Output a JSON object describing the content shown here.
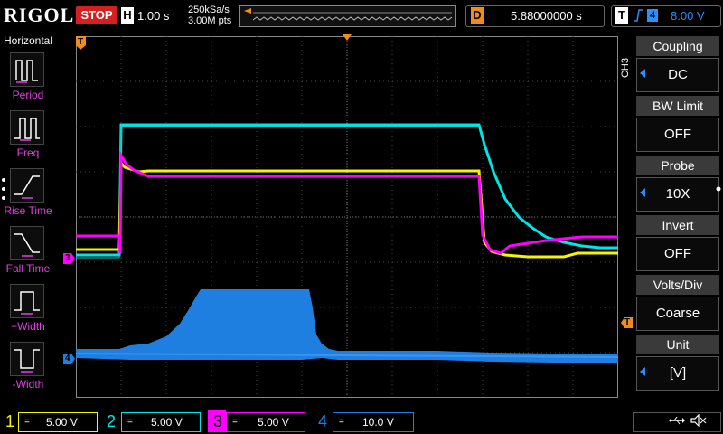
{
  "topbar": {
    "brand": "RIGOL",
    "run_state": "STOP",
    "h_badge": "H",
    "timebase": "1.00 s",
    "sample_rate": "250kSa/s",
    "memory_depth": "3.00M pts",
    "delay_badge": "D",
    "delay_value": "5.88000000 s",
    "trigger_badge": "T",
    "trigger_edge_icon": "rising-edge-icon",
    "trigger_source": "4",
    "trigger_level": "8.00 V"
  },
  "left_menu": {
    "header": "Horizontal",
    "items": [
      {
        "label": "Period",
        "icon": "period-measure-icon"
      },
      {
        "label": "Freq",
        "icon": "frequency-measure-icon"
      },
      {
        "label": "Rise Time",
        "icon": "rise-time-measure-icon"
      },
      {
        "label": "Fall Time",
        "icon": "fall-time-measure-icon"
      },
      {
        "label": "+Width",
        "icon": "positive-width-measure-icon"
      },
      {
        "label": "-Width",
        "icon": "negative-width-measure-icon"
      }
    ]
  },
  "right_menu": {
    "channel_tab": "CH3",
    "items": [
      {
        "title": "Coupling",
        "value": "DC"
      },
      {
        "title": "BW Limit",
        "value": "OFF"
      },
      {
        "title": "Probe",
        "value": "10X"
      },
      {
        "title": "Invert",
        "value": "OFF"
      },
      {
        "title": "Volts/Div",
        "value": "Coarse"
      },
      {
        "title": "Unit",
        "value": "[V]"
      }
    ]
  },
  "markers": {
    "trigger_position": "T",
    "ch3": "3",
    "ch4": "4",
    "trigger_level": "T"
  },
  "channels": [
    {
      "num": "1",
      "coupling": "=",
      "scale": "5.00 V",
      "color": "#f5f500"
    },
    {
      "num": "2",
      "coupling": "=",
      "scale": "5.00 V",
      "color": "#00e5e5"
    },
    {
      "num": "3",
      "coupling": "=",
      "scale": "5.00 V",
      "color": "#ff00ff"
    },
    {
      "num": "4",
      "coupling": "=",
      "scale": "10.0 V",
      "color": "#1e7fe0"
    }
  ],
  "status_icons": [
    "usb-icon",
    "speaker-muted-icon"
  ],
  "colors": {
    "ch1": "#f5f500",
    "ch2": "#00e5e5",
    "ch3": "#ff00ff",
    "ch4": "#1e7fe0",
    "stop": "#d62020",
    "delay": "#f08c1a",
    "menu_label": "#e040e0"
  }
}
